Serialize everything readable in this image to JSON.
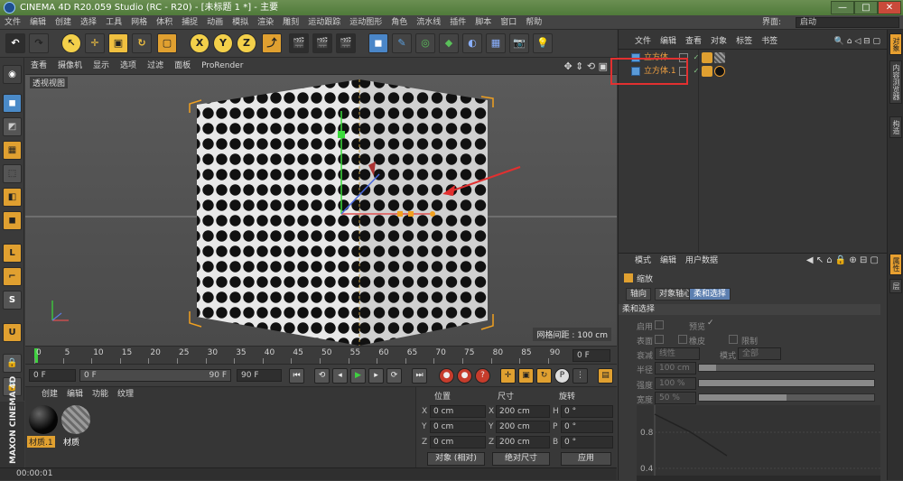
{
  "window": {
    "title": "CINEMA 4D R20.059 Studio (RC - R20) - [未标题 1 *] - 主要",
    "min": "—",
    "max": "□",
    "close": "✕"
  },
  "menu": {
    "items": [
      "文件",
      "编辑",
      "创建",
      "选择",
      "工具",
      "网格",
      "体积",
      "捕捉",
      "动画",
      "模拟",
      "渲染",
      "雕刻",
      "运动跟踪",
      "运动图形",
      "角色",
      "流水线",
      "插件",
      "脚本",
      "窗口",
      "帮助"
    ],
    "layout_label": "界面:",
    "layout_value": "启动"
  },
  "toolbar": {
    "axis_x": "X",
    "axis_y": "Y",
    "axis_z": "Z"
  },
  "viewport": {
    "menu": [
      "查看",
      "摄像机",
      "显示",
      "选项",
      "过滤",
      "面板",
      "ProRender"
    ],
    "label": "透视视图",
    "grid_spacing": "网格间距 : 100 cm"
  },
  "timeline": {
    "ticks": [
      "0",
      "5",
      "10",
      "15",
      "20",
      "25",
      "30",
      "35",
      "40",
      "45",
      "50",
      "55",
      "60",
      "65",
      "70",
      "75",
      "80",
      "85",
      "90"
    ],
    "current_frame": "0 F",
    "start_frame": "0 F",
    "min_frame": "0 F",
    "max_frame": "90 F",
    "end_frame": "90 F"
  },
  "materials": {
    "menu": [
      "创建",
      "编辑",
      "功能",
      "纹理"
    ],
    "items": [
      {
        "name": "材质.1",
        "color": "#111111"
      },
      {
        "name": "材质",
        "color": "#8a8a8a"
      }
    ]
  },
  "coords": {
    "headers": [
      "位置",
      "尺寸",
      "旋转"
    ],
    "rows": [
      {
        "axis": "X",
        "pos": "0 cm",
        "size_axis": "X",
        "size": "200 cm",
        "rot_axis": "H",
        "rot": "0 °"
      },
      {
        "axis": "Y",
        "pos": "0 cm",
        "size_axis": "Y",
        "size": "200 cm",
        "rot_axis": "P",
        "rot": "0 °"
      },
      {
        "axis": "Z",
        "pos": "0 cm",
        "size_axis": "Z",
        "size": "200 cm",
        "rot_axis": "B",
        "rot": "0 °"
      }
    ],
    "mode": "对象 (相对)",
    "size_mode": "绝对尺寸",
    "apply": "应用"
  },
  "status": {
    "time": "00:00:01",
    "maxon": "MAXON CINEMA 4D"
  },
  "object_manager": {
    "menu": [
      "文件",
      "编辑",
      "查看",
      "对象",
      "标签",
      "书签"
    ],
    "objects": [
      {
        "name": "立方体",
        "check": "✓"
      },
      {
        "name": "立方体.1",
        "check": "✓"
      }
    ]
  },
  "attribute_manager": {
    "menu": [
      "模式",
      "编辑",
      "用户数据"
    ],
    "title": "缩放",
    "tabs": [
      "轴向",
      "对象轴心",
      "柔和选择"
    ],
    "section": "柔和选择",
    "rows": {
      "enable": "启用",
      "preview": "预览",
      "surface": "表面",
      "rubber": "橡皮",
      "restrict": "限制",
      "falloff_label": "衰减",
      "falloff_value": "线性",
      "mode_label": "模式",
      "mode_value": "全部",
      "radius_label": "半径",
      "radius_value": "100 cm",
      "strength_label": "强度",
      "strength_value": "100 %",
      "width_label": "宽度",
      "width_value": "50 %"
    },
    "graph_ticks": [
      "0.8",
      "0.4"
    ]
  },
  "right_tabs": [
    "对象",
    "内容浏览器",
    "构造",
    "属性",
    "层"
  ]
}
